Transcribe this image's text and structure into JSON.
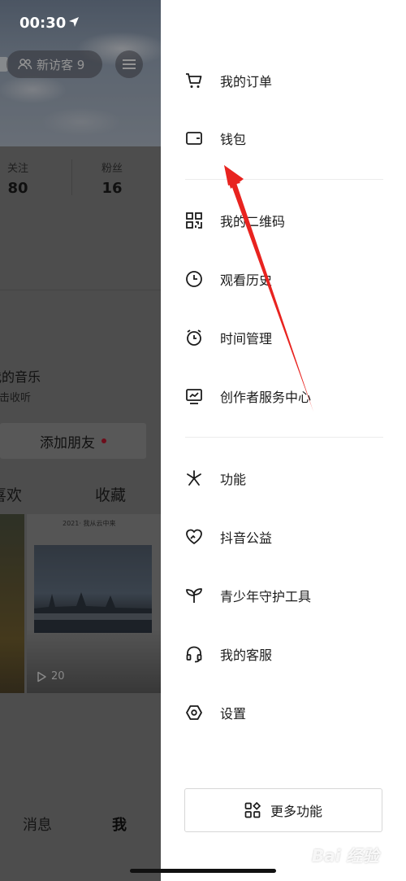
{
  "status": {
    "time": "00:30"
  },
  "profile": {
    "visitor_label": "新访客 9",
    "following_label": "关注",
    "following_count": "80",
    "fans_label": "粉丝",
    "fans_count": "16",
    "music_title": "我的音乐",
    "music_sub": "点击收听",
    "add_friend": "添加朋友",
    "tab_like": "喜欢",
    "tab_favorites": "收藏",
    "video_caption": "2021· 我从云中来",
    "play_count": "20",
    "nav_messages": "消息",
    "nav_me": "我"
  },
  "drawer": {
    "group1": [
      {
        "label": "我的订单",
        "icon": "cart-icon"
      },
      {
        "label": "钱包",
        "icon": "wallet-icon"
      }
    ],
    "group2": [
      {
        "label": "我的二维码",
        "icon": "qr-code-icon"
      },
      {
        "label": "观看历史",
        "icon": "clock-icon"
      },
      {
        "label": "时间管理",
        "icon": "alarm-clock-icon"
      },
      {
        "label": "创作者服务中心",
        "icon": "creator-monitor-icon"
      }
    ],
    "group3": [
      {
        "label": "功能",
        "icon": "sparkle-icon"
      },
      {
        "label": "抖音公益",
        "icon": "charity-heart-icon"
      },
      {
        "label": "青少年守护工具",
        "icon": "sprout-icon"
      },
      {
        "label": "我的客服",
        "icon": "headset-icon"
      },
      {
        "label": "设置",
        "icon": "settings-hexagon-icon"
      }
    ],
    "more_functions": "更多功能"
  },
  "colors": {
    "annotation_arrow": "#e8231f",
    "drawer_bg": "#ffffff",
    "dim_overlay": "#7d7d7d"
  },
  "watermark": "Bai 经验"
}
